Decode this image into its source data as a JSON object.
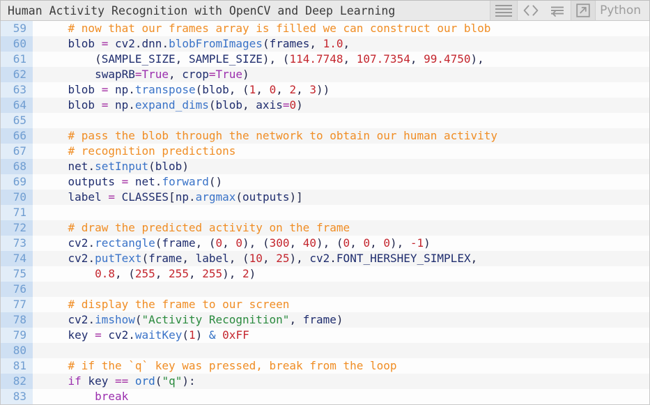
{
  "header": {
    "title": "Human Activity Recognition with OpenCV and Deep Learning",
    "language": "Python",
    "icons": {
      "menu": "hamburger-menu-icon",
      "code": "code-brackets-icon",
      "wrap": "toggle-word-wrap-icon",
      "popout": "open-in-new-window-icon"
    },
    "colors": {
      "background": "#e9e9e9",
      "title_text": "#3b3b3b",
      "icon": "#9a9a9a",
      "language_text": "#9d9d9d"
    }
  },
  "editor": {
    "language": "Python",
    "first_line_number": 59,
    "last_line_number": 83,
    "gutter_color": "#cfe0f3",
    "line_number_color": "#6f9dd1",
    "syntax_colors": {
      "comment": "#f08d24",
      "string": "#2a8a3e",
      "number": "#c4262e",
      "keyword": "#9b2fae",
      "operator": "#a32fa3",
      "function": "#3a73c8",
      "plain": "#20264b"
    },
    "lines": [
      {
        "n": 59,
        "tokens": [
          {
            "t": "com",
            "s": "    # now that our frames array is filled we can construct our blob"
          }
        ]
      },
      {
        "n": 60,
        "tokens": [
          {
            "t": "pl",
            "s": "    "
          },
          {
            "t": "var",
            "s": "blob"
          },
          {
            "t": "pl",
            "s": " "
          },
          {
            "t": "op",
            "s": "="
          },
          {
            "t": "pl",
            "s": " "
          },
          {
            "t": "var",
            "s": "cv2"
          },
          {
            "t": "pl",
            "s": "."
          },
          {
            "t": "var",
            "s": "dnn"
          },
          {
            "t": "pl",
            "s": "."
          },
          {
            "t": "fn",
            "s": "blobFromImages"
          },
          {
            "t": "pl",
            "s": "("
          },
          {
            "t": "var",
            "s": "frames"
          },
          {
            "t": "pl",
            "s": ", "
          },
          {
            "t": "num",
            "s": "1.0"
          },
          {
            "t": "pl",
            "s": ","
          }
        ]
      },
      {
        "n": 61,
        "tokens": [
          {
            "t": "pl",
            "s": "        ("
          },
          {
            "t": "const",
            "s": "SAMPLE_SIZE"
          },
          {
            "t": "pl",
            "s": ", "
          },
          {
            "t": "const",
            "s": "SAMPLE_SIZE"
          },
          {
            "t": "pl",
            "s": "), ("
          },
          {
            "t": "num",
            "s": "114.7748"
          },
          {
            "t": "pl",
            "s": ", "
          },
          {
            "t": "num",
            "s": "107.7354"
          },
          {
            "t": "pl",
            "s": ", "
          },
          {
            "t": "num",
            "s": "99.4750"
          },
          {
            "t": "pl",
            "s": "),"
          }
        ]
      },
      {
        "n": 62,
        "tokens": [
          {
            "t": "pl",
            "s": "        "
          },
          {
            "t": "var",
            "s": "swapRB"
          },
          {
            "t": "op",
            "s": "="
          },
          {
            "t": "kw",
            "s": "True"
          },
          {
            "t": "pl",
            "s": ", "
          },
          {
            "t": "var",
            "s": "crop"
          },
          {
            "t": "op",
            "s": "="
          },
          {
            "t": "kw",
            "s": "True"
          },
          {
            "t": "pl",
            "s": ")"
          }
        ]
      },
      {
        "n": 63,
        "tokens": [
          {
            "t": "pl",
            "s": "    "
          },
          {
            "t": "var",
            "s": "blob"
          },
          {
            "t": "pl",
            "s": " "
          },
          {
            "t": "op",
            "s": "="
          },
          {
            "t": "pl",
            "s": " "
          },
          {
            "t": "var",
            "s": "np"
          },
          {
            "t": "pl",
            "s": "."
          },
          {
            "t": "fn",
            "s": "transpose"
          },
          {
            "t": "pl",
            "s": "("
          },
          {
            "t": "var",
            "s": "blob"
          },
          {
            "t": "pl",
            "s": ", ("
          },
          {
            "t": "num",
            "s": "1"
          },
          {
            "t": "pl",
            "s": ", "
          },
          {
            "t": "num",
            "s": "0"
          },
          {
            "t": "pl",
            "s": ", "
          },
          {
            "t": "num",
            "s": "2"
          },
          {
            "t": "pl",
            "s": ", "
          },
          {
            "t": "num",
            "s": "3"
          },
          {
            "t": "pl",
            "s": "))"
          }
        ]
      },
      {
        "n": 64,
        "tokens": [
          {
            "t": "pl",
            "s": "    "
          },
          {
            "t": "var",
            "s": "blob"
          },
          {
            "t": "pl",
            "s": " "
          },
          {
            "t": "op",
            "s": "="
          },
          {
            "t": "pl",
            "s": " "
          },
          {
            "t": "var",
            "s": "np"
          },
          {
            "t": "pl",
            "s": "."
          },
          {
            "t": "fn",
            "s": "expand_dims"
          },
          {
            "t": "pl",
            "s": "("
          },
          {
            "t": "var",
            "s": "blob"
          },
          {
            "t": "pl",
            "s": ", "
          },
          {
            "t": "var",
            "s": "axis"
          },
          {
            "t": "op",
            "s": "="
          },
          {
            "t": "num",
            "s": "0"
          },
          {
            "t": "pl",
            "s": ")"
          }
        ]
      },
      {
        "n": 65,
        "tokens": [
          {
            "t": "pl",
            "s": ""
          }
        ]
      },
      {
        "n": 66,
        "tokens": [
          {
            "t": "com",
            "s": "    # pass the blob through the network to obtain our human activity"
          }
        ]
      },
      {
        "n": 67,
        "tokens": [
          {
            "t": "com",
            "s": "    # recognition predictions"
          }
        ]
      },
      {
        "n": 68,
        "tokens": [
          {
            "t": "pl",
            "s": "    "
          },
          {
            "t": "var",
            "s": "net"
          },
          {
            "t": "pl",
            "s": "."
          },
          {
            "t": "fn",
            "s": "setInput"
          },
          {
            "t": "pl",
            "s": "("
          },
          {
            "t": "var",
            "s": "blob"
          },
          {
            "t": "pl",
            "s": ")"
          }
        ]
      },
      {
        "n": 69,
        "tokens": [
          {
            "t": "pl",
            "s": "    "
          },
          {
            "t": "var",
            "s": "outputs"
          },
          {
            "t": "pl",
            "s": " "
          },
          {
            "t": "op",
            "s": "="
          },
          {
            "t": "pl",
            "s": " "
          },
          {
            "t": "var",
            "s": "net"
          },
          {
            "t": "pl",
            "s": "."
          },
          {
            "t": "fn",
            "s": "forward"
          },
          {
            "t": "pl",
            "s": "()"
          }
        ]
      },
      {
        "n": 70,
        "tokens": [
          {
            "t": "pl",
            "s": "    "
          },
          {
            "t": "var",
            "s": "label"
          },
          {
            "t": "pl",
            "s": " "
          },
          {
            "t": "op",
            "s": "="
          },
          {
            "t": "pl",
            "s": " "
          },
          {
            "t": "const",
            "s": "CLASSES"
          },
          {
            "t": "pl",
            "s": "["
          },
          {
            "t": "var",
            "s": "np"
          },
          {
            "t": "pl",
            "s": "."
          },
          {
            "t": "fn",
            "s": "argmax"
          },
          {
            "t": "pl",
            "s": "("
          },
          {
            "t": "var",
            "s": "outputs"
          },
          {
            "t": "pl",
            "s": ")]"
          }
        ]
      },
      {
        "n": 71,
        "tokens": [
          {
            "t": "pl",
            "s": ""
          }
        ]
      },
      {
        "n": 72,
        "tokens": [
          {
            "t": "com",
            "s": "    # draw the predicted activity on the frame"
          }
        ]
      },
      {
        "n": 73,
        "tokens": [
          {
            "t": "pl",
            "s": "    "
          },
          {
            "t": "var",
            "s": "cv2"
          },
          {
            "t": "pl",
            "s": "."
          },
          {
            "t": "fn",
            "s": "rectangle"
          },
          {
            "t": "pl",
            "s": "("
          },
          {
            "t": "var",
            "s": "frame"
          },
          {
            "t": "pl",
            "s": ", ("
          },
          {
            "t": "num",
            "s": "0"
          },
          {
            "t": "pl",
            "s": ", "
          },
          {
            "t": "num",
            "s": "0"
          },
          {
            "t": "pl",
            "s": "), ("
          },
          {
            "t": "num",
            "s": "300"
          },
          {
            "t": "pl",
            "s": ", "
          },
          {
            "t": "num",
            "s": "40"
          },
          {
            "t": "pl",
            "s": "), ("
          },
          {
            "t": "num",
            "s": "0"
          },
          {
            "t": "pl",
            "s": ", "
          },
          {
            "t": "num",
            "s": "0"
          },
          {
            "t": "pl",
            "s": ", "
          },
          {
            "t": "num",
            "s": "0"
          },
          {
            "t": "pl",
            "s": "), "
          },
          {
            "t": "num",
            "s": "-1"
          },
          {
            "t": "pl",
            "s": ")"
          }
        ]
      },
      {
        "n": 74,
        "tokens": [
          {
            "t": "pl",
            "s": "    "
          },
          {
            "t": "var",
            "s": "cv2"
          },
          {
            "t": "pl",
            "s": "."
          },
          {
            "t": "fn",
            "s": "putText"
          },
          {
            "t": "pl",
            "s": "("
          },
          {
            "t": "var",
            "s": "frame"
          },
          {
            "t": "pl",
            "s": ", "
          },
          {
            "t": "var",
            "s": "label"
          },
          {
            "t": "pl",
            "s": ", ("
          },
          {
            "t": "num",
            "s": "10"
          },
          {
            "t": "pl",
            "s": ", "
          },
          {
            "t": "num",
            "s": "25"
          },
          {
            "t": "pl",
            "s": "), "
          },
          {
            "t": "var",
            "s": "cv2"
          },
          {
            "t": "pl",
            "s": "."
          },
          {
            "t": "const",
            "s": "FONT_HERSHEY_SIMPLEX"
          },
          {
            "t": "pl",
            "s": ","
          }
        ]
      },
      {
        "n": 75,
        "tokens": [
          {
            "t": "pl",
            "s": "        "
          },
          {
            "t": "num",
            "s": "0.8"
          },
          {
            "t": "pl",
            "s": ", ("
          },
          {
            "t": "num",
            "s": "255"
          },
          {
            "t": "pl",
            "s": ", "
          },
          {
            "t": "num",
            "s": "255"
          },
          {
            "t": "pl",
            "s": ", "
          },
          {
            "t": "num",
            "s": "255"
          },
          {
            "t": "pl",
            "s": "), "
          },
          {
            "t": "num",
            "s": "2"
          },
          {
            "t": "pl",
            "s": ")"
          }
        ]
      },
      {
        "n": 76,
        "tokens": [
          {
            "t": "pl",
            "s": ""
          }
        ]
      },
      {
        "n": 77,
        "tokens": [
          {
            "t": "com",
            "s": "    # display the frame to our screen"
          }
        ]
      },
      {
        "n": 78,
        "tokens": [
          {
            "t": "pl",
            "s": "    "
          },
          {
            "t": "var",
            "s": "cv2"
          },
          {
            "t": "pl",
            "s": "."
          },
          {
            "t": "fn",
            "s": "imshow"
          },
          {
            "t": "pl",
            "s": "("
          },
          {
            "t": "str",
            "s": "\"Activity Recognition\""
          },
          {
            "t": "pl",
            "s": ", "
          },
          {
            "t": "var",
            "s": "frame"
          },
          {
            "t": "pl",
            "s": ")"
          }
        ]
      },
      {
        "n": 79,
        "tokens": [
          {
            "t": "pl",
            "s": "    "
          },
          {
            "t": "var",
            "s": "key"
          },
          {
            "t": "pl",
            "s": " "
          },
          {
            "t": "op",
            "s": "="
          },
          {
            "t": "pl",
            "s": " "
          },
          {
            "t": "var",
            "s": "cv2"
          },
          {
            "t": "pl",
            "s": "."
          },
          {
            "t": "fn",
            "s": "waitKey"
          },
          {
            "t": "pl",
            "s": "("
          },
          {
            "t": "num",
            "s": "1"
          },
          {
            "t": "pl",
            "s": ") "
          },
          {
            "t": "amp",
            "s": "&"
          },
          {
            "t": "pl",
            "s": " "
          },
          {
            "t": "num",
            "s": "0xFF"
          }
        ]
      },
      {
        "n": 80,
        "tokens": [
          {
            "t": "pl",
            "s": ""
          }
        ]
      },
      {
        "n": 81,
        "tokens": [
          {
            "t": "com",
            "s": "    # if the `q` key was pressed, break from the loop"
          }
        ]
      },
      {
        "n": 82,
        "tokens": [
          {
            "t": "pl",
            "s": "    "
          },
          {
            "t": "kw",
            "s": "if"
          },
          {
            "t": "pl",
            "s": " "
          },
          {
            "t": "var",
            "s": "key"
          },
          {
            "t": "pl",
            "s": " "
          },
          {
            "t": "op",
            "s": "=="
          },
          {
            "t": "pl",
            "s": " "
          },
          {
            "t": "bi",
            "s": "ord"
          },
          {
            "t": "pl",
            "s": "("
          },
          {
            "t": "str",
            "s": "\"q\""
          },
          {
            "t": "pl",
            "s": "):"
          }
        ]
      },
      {
        "n": 83,
        "tokens": [
          {
            "t": "pl",
            "s": "        "
          },
          {
            "t": "kw",
            "s": "break"
          }
        ]
      }
    ]
  }
}
